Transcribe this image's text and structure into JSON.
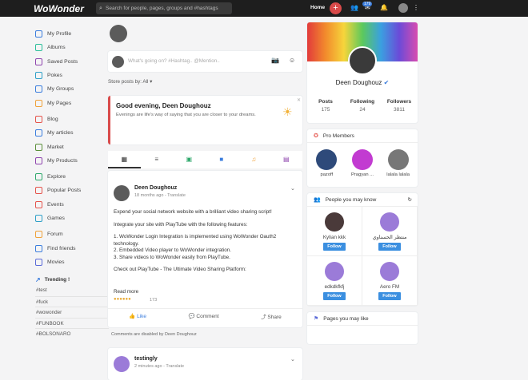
{
  "topbar": {
    "logo": "WoWonder",
    "search_placeholder": "Search for people, pages, groups and #hashtags",
    "home": "Home",
    "plus": "+",
    "badge": "179"
  },
  "sidebar": {
    "items": [
      {
        "label": "My Profile",
        "color": "#3b7ddd"
      },
      {
        "label": "Albums",
        "color": "#2bbf9a"
      },
      {
        "label": "Saved Posts",
        "color": "#8e44ad"
      },
      {
        "label": "Pokes",
        "color": "#2ea0c8"
      },
      {
        "label": "My Groups",
        "color": "#3b7ddd"
      },
      {
        "label": "My Pages",
        "color": "#f0a13a"
      },
      {
        "label": "Blog",
        "color": "#e5534b"
      },
      {
        "label": "My articles",
        "color": "#3b7ddd"
      },
      {
        "label": "Market",
        "color": "#5a8f3a"
      },
      {
        "label": "My Products",
        "color": "#8e44ad"
      },
      {
        "label": "Explore",
        "color": "#2ea86b"
      },
      {
        "label": "Popular Posts",
        "color": "#e5534b"
      },
      {
        "label": "Events",
        "color": "#e5534b"
      },
      {
        "label": "Games",
        "color": "#2ea0c8"
      },
      {
        "label": "Forum",
        "color": "#f0a13a"
      },
      {
        "label": "Find friends",
        "color": "#3b7ddd"
      },
      {
        "label": "Movies",
        "color": "#5b6bd8"
      }
    ],
    "trending_label": "Trending !",
    "tags": [
      "#test",
      "#fuck",
      "#wowonder",
      "#FUNBOOK",
      "#BOLSONARO"
    ]
  },
  "composer": {
    "placeholder": "What's going on? #Hashtag.. @Mention.."
  },
  "filter": {
    "label": "Store posts by: All ▾"
  },
  "greeting": {
    "title": "Good evening, Deen Doughouz",
    "subtitle": "Evenings are life's way of saying that you are closer to your dreams."
  },
  "post": {
    "author": "Deen Doughouz",
    "time": "18 months ago - Translate",
    "paragraphs": [
      "Expend your social network website with a brilliant video sharing script!",
      "Integrate your site with PlayTube with the following features:",
      "1. WoWonder Login Integration is implemented using WoWonder Oauth2 technology.\n2. Embedded Video player to WoWonder integration.\n3. Share videos to WoWonder easily from PlayTube.",
      "Check out PlayTube - The Ultimate Video Sharing Platform:"
    ],
    "read_more": "Read more",
    "reactions_count": "173",
    "like": "Like",
    "comment": "Comment",
    "share": "Share",
    "comments_disabled": "Comments are disabled by Deen Doughouz"
  },
  "post2": {
    "author": "testingly",
    "time": "2 minutes ago - Translate"
  },
  "profile": {
    "name": "Deen Doughouz",
    "stats": [
      {
        "label": "Posts",
        "value": "175"
      },
      {
        "label": "Following",
        "value": "24"
      },
      {
        "label": "Followers",
        "value": "3811"
      }
    ]
  },
  "pro_members": {
    "title": "Pro Members",
    "members": [
      {
        "name": "pazoff"
      },
      {
        "name": "Pragyan ..."
      },
      {
        "name": "lalala lalala"
      }
    ]
  },
  "people": {
    "title": "People you may know",
    "follow": "Follow",
    "list": [
      {
        "name": "Kylian kkk"
      },
      {
        "name": "منتظر الحسناوي"
      },
      {
        "name": "edkdkfkfj"
      },
      {
        "name": "Aero FM"
      }
    ]
  },
  "pages": {
    "title": "Pages you may like"
  }
}
